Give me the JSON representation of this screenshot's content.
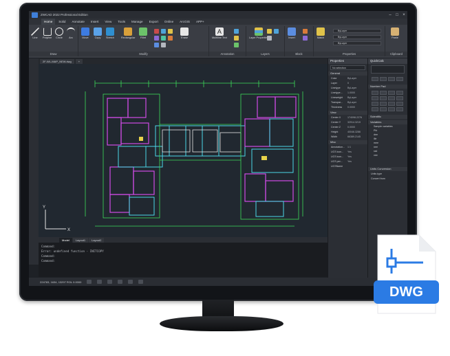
{
  "app": {
    "title": "ZWCAD 2022 Professional Edition",
    "tabs": [
      "Home",
      "Solid",
      "Annotate",
      "Insert",
      "View",
      "Tools",
      "Manage",
      "Export",
      "Online",
      "ArcGIS",
      "APP+"
    ],
    "active_tab": "Home"
  },
  "ribbon": {
    "groups": [
      {
        "label": "Draw"
      },
      {
        "label": "Modify"
      },
      {
        "label": "Annotation"
      },
      {
        "label": "Layers"
      },
      {
        "label": "Block"
      },
      {
        "label": "Properties"
      },
      {
        "label": "Clipboard"
      }
    ],
    "buttons": {
      "line": "Line",
      "polyline": "Polyline",
      "circle": "Circle",
      "arc": "Arc",
      "move": "Move",
      "copy": "Copy",
      "stretch": "Stretch",
      "rectangular": "Rectangular",
      "fillet": "Fillet",
      "erase": "Erase",
      "multiline_text": "Multiline Text",
      "layer_properties": "Layer Properties",
      "insert": "Insert",
      "match": "Match",
      "paste": "Paste"
    },
    "combo_layer": "ByLayer"
  },
  "document": {
    "tab_label": "2F-WL-MAP_NEW.dwg"
  },
  "model_tabs": [
    "Model",
    "Layout1",
    "Layout2"
  ],
  "command_line": {
    "rows": [
      "Command:",
      "Error: undefined function - INITCOPY",
      "Command:",
      "Command:"
    ]
  },
  "status": {
    "coords": "224783, 1634, 13297 ROL 0.0000"
  },
  "properties_panel": {
    "title": "Properties",
    "selection": "No selection",
    "sections": {
      "general": "General",
      "view": "View",
      "misc": "Misc"
    },
    "general_rows": [
      {
        "k": "Color",
        "v": "ByLayer"
      },
      {
        "k": "Layer",
        "v": "0"
      },
      {
        "k": "Linetype",
        "v": "ByLayer"
      },
      {
        "k": "Linetype...",
        "v": "1.0000"
      },
      {
        "k": "Lineweight",
        "v": "ByLayer"
      },
      {
        "k": "Transpar...",
        "v": "ByLayer"
      },
      {
        "k": "Thickness",
        "v": "0.0000"
      }
    ],
    "view_rows": [
      {
        "k": "Center X",
        "v": "174098.2276"
      },
      {
        "k": "Center Y",
        "v": "32914.3219"
      },
      {
        "k": "Center Z",
        "v": "0.0000"
      },
      {
        "k": "Height",
        "v": "40046.3286"
      },
      {
        "k": "Width",
        "v": "66389.2145"
      }
    ],
    "misc_rows": [
      {
        "k": "Annotation...",
        "v": "1:1"
      },
      {
        "k": "UCS icon...",
        "v": "Yes"
      },
      {
        "k": "UCS icon...",
        "v": "Yes"
      },
      {
        "k": "UCS per...",
        "v": "Yes"
      },
      {
        "k": "UCSName",
        "v": ""
      }
    ]
  },
  "quick_panel": {
    "title": "QuickCalc",
    "number_pad": "Number Pad",
    "scientific": "Scientific",
    "variables": "Variables",
    "units": "Units Conversion",
    "unit_type": "Units type",
    "convert_from": "Convert from",
    "tree_items": [
      "Sample variables",
      "Phi",
      "dee",
      "ille",
      "mee",
      "nee",
      "rad",
      "vee"
    ]
  },
  "badge": {
    "label": "DWG",
    "color": "#2b7be4"
  },
  "colors": {
    "wall_green": "#3ddc5a",
    "wall_magenta": "#d04be6",
    "wall_cyan": "#4ad7e8",
    "dim_white": "#e6e6e6",
    "canvas": "#212830"
  }
}
